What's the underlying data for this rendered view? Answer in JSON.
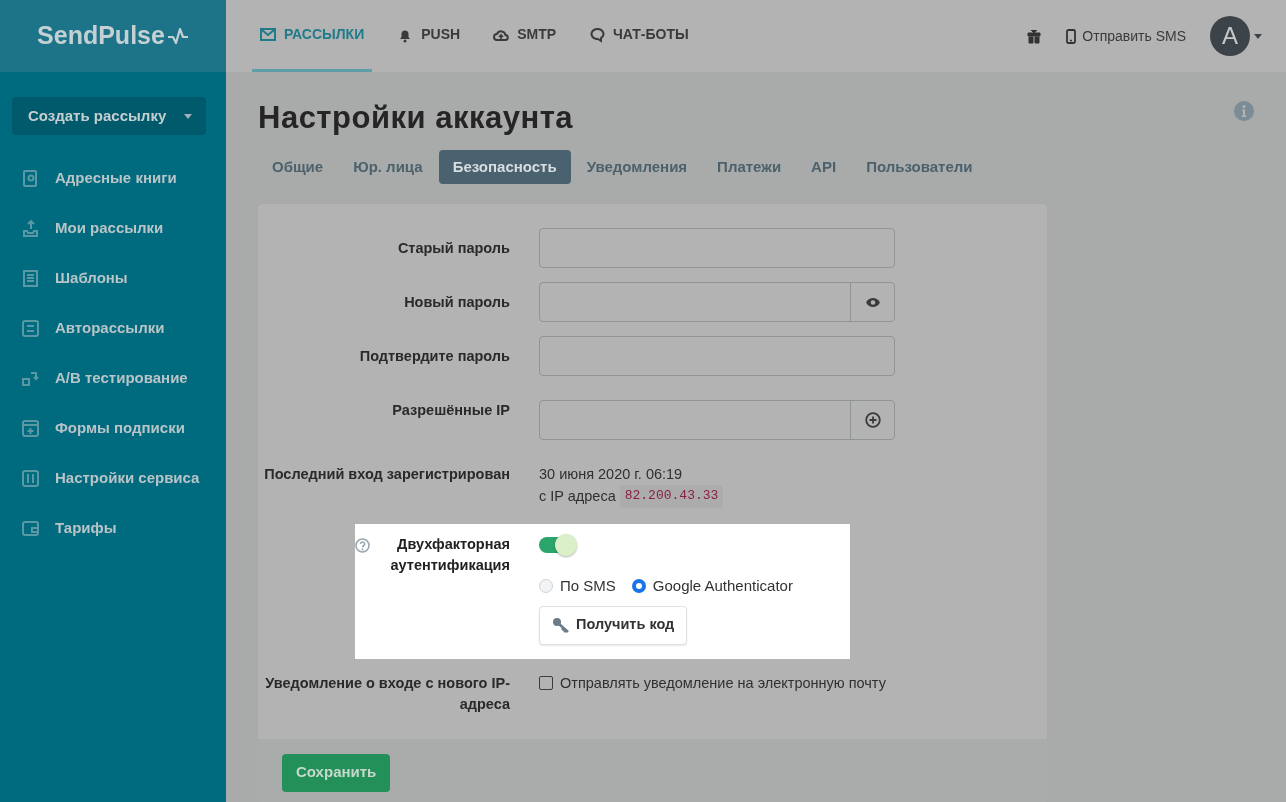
{
  "logo": {
    "text": "SendPulse"
  },
  "sidebar": {
    "create_button": "Создать рассылку",
    "items": [
      {
        "label": "Адресные книги"
      },
      {
        "label": "Мои рассылки"
      },
      {
        "label": "Шаблоны"
      },
      {
        "label": "Авторассылки"
      },
      {
        "label": "A/B тестирование"
      },
      {
        "label": "Формы подписки"
      },
      {
        "label": "Настройки сервиса"
      },
      {
        "label": "Тарифы"
      }
    ]
  },
  "top_nav": [
    {
      "label": "РАССЫЛКИ",
      "selected": true
    },
    {
      "label": "PUSH",
      "selected": false
    },
    {
      "label": "SMTP",
      "selected": false
    },
    {
      "label": "ЧАТ-БОТЫ",
      "selected": false
    }
  ],
  "header": {
    "send_sms": "Отправить SMS",
    "avatar": "A"
  },
  "page_title": "Настройки аккаунта",
  "tabs": [
    {
      "label": "Общие",
      "selected": false
    },
    {
      "label": "Юр. лица",
      "selected": false
    },
    {
      "label": "Безопасность",
      "selected": true
    },
    {
      "label": "Уведомления",
      "selected": false
    },
    {
      "label": "Платежи",
      "selected": false
    },
    {
      "label": "API",
      "selected": false
    },
    {
      "label": "Пользователи",
      "selected": false
    }
  ],
  "form": [
    {
      "kind": "input",
      "label": "Старый пароль"
    },
    {
      "kind": "input_eye",
      "label": "Новый пароль"
    },
    {
      "kind": "input",
      "label": "Подтвердите пароль"
    },
    {
      "kind": "input_add",
      "label": "Разрешённые IP"
    },
    {
      "kind": "info",
      "label": "Последний вход зарегистрирован",
      "line_1": "30 июня 2020 г. 06:19",
      "line_2": "с IP адреса",
      "ip": "82.200.43.33"
    },
    {
      "kind": "twofactor",
      "label": "Двухфакторная аутентификация",
      "on": true,
      "radios": [
        {
          "label": "По SMS",
          "selected": false
        },
        {
          "label": "Google Authenticator",
          "selected": true
        }
      ],
      "button": "Получить код"
    },
    {
      "kind": "checkbox",
      "label": "Уведомление о входе с нового IP-адреса",
      "checkbox_label": "Отправлять уведомление на электронную почту",
      "checked": false
    }
  ],
  "save_button": "Сохранить"
}
